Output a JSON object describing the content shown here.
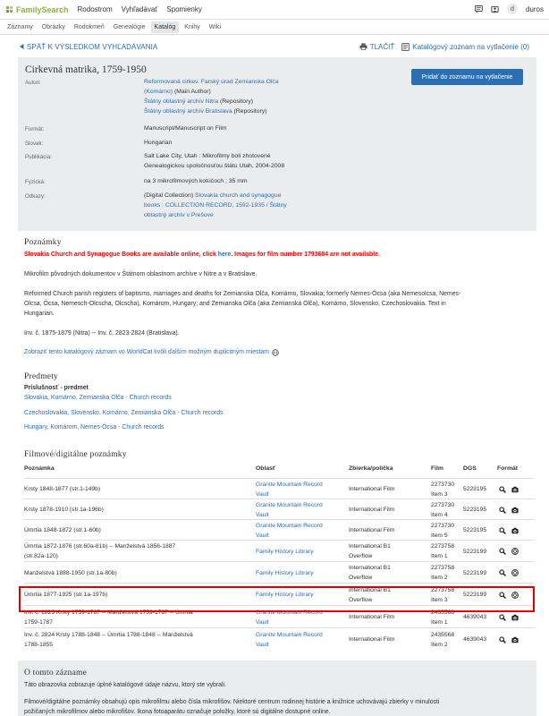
{
  "header": {
    "logo": "FamilySearch",
    "nav": [
      "Rodostrom",
      "Vyhľadávať",
      "Spomienky"
    ],
    "user": "duros",
    "avatar_letter": "d"
  },
  "subnav": {
    "tabs": [
      "Záznamy",
      "Obrázky",
      "Rodokmeň",
      "Genealógie",
      "Katalóg",
      "Knihy",
      "Wiki"
    ],
    "active": "Katalóg"
  },
  "actions": {
    "back": "SPÄŤ K VÝSLEDKOM VYHĽADÁVANIA",
    "print": "TLAČIŤ",
    "print_list": "Katalógový zoznam na vytlačenie (0)"
  },
  "record": {
    "title": "Cirkevná matrika, 1759-1950",
    "add_button": "Pridať do zoznamu na vytlačenie",
    "authors_label": "Autori:",
    "authors": [
      {
        "name": "Reformovaná cirkev. Farský úrad Zemianska Olča",
        "name2": "(Komárno)",
        "role": "(Main Author)"
      },
      {
        "name": "Štátny oblastný archív Nitra",
        "role": "(Repository)"
      },
      {
        "name": "Štátny oblastný archív Bratislava",
        "role": "(Repository)"
      }
    ],
    "format_label": "Formát:",
    "format": "Manuscript/Manuscript on Film",
    "language_label": "Slovak:",
    "language": "Hungarian",
    "publication_label": "Publikácia:",
    "publication_1": "Salt Lake City, Utah : Mikrofilmy boli zhotovené",
    "publication_2": "Genealogickou spoločnosťou štátu Utah, 2004-2008",
    "physical_label": "Fyzická:",
    "physical": "na 3 mikrofilmových kotúčoch ; 35 mm",
    "references_label": "Odkazy:",
    "ref_prefix": "(Digital Collection)",
    "ref_link_1": "Slovakia church and synagogue",
    "ref_link_2": "books : COLLECTION RECORD, 1592-1935 / Štátny",
    "ref_link_3": "oblastný archív v Prešove"
  },
  "notes": {
    "heading": "Poznámky",
    "red_1": "Slovakia Church and Synagogue Books are available online, click",
    "red_link": "here",
    "red_2": ". Images for film number 1793684 are not available.",
    "p1": "Mikrofilm pôvodných dokumentov v Štátnom oblastnom archíve v Nitre a v Bratislave.",
    "p2_1": "Reformed Church parish registers of baptisms, marriages and deaths for Zemianska Olča, Komárno, Slovakia; formerly Nemes-Ócsa (aka Nemesolcsa, Nemes-",
    "p2_2": "Olcsa, Ócsa, Nemesch-Olcscha, Olcscha), Komárom, Hungary; and Zemianska Olča (aka Zemianská Olča), Komárno, Slovensko, Czechoslovakia. Text in",
    "p2_3": "Hungarian.",
    "p3": "Inv. č. 1875-1879 (Nitra) -- Inv. č. 2823-2824 (Bratislava).",
    "worldcat": "Zobraziť tento katalógový záznam vo WorldCat kvôli ďalším možným duplicitným miestam"
  },
  "subjects": {
    "heading": "Predmety",
    "subheading": "Príslušnosť - predmet",
    "items": [
      "Slovakia, Komárno, Zemianska Olča - Church records",
      "Czechoslovakia, Slovensko, Komárno, Zemianska Olča - Church records",
      "Hungary, Komárom, Nemes-Ócsa - Church records"
    ]
  },
  "films": {
    "heading": "Filmové/digitálne poznámky",
    "columns": [
      "Poznámka",
      "Oblasť",
      "Zbierka/polička",
      "Film",
      "DGS",
      "Formát"
    ],
    "rows": [
      {
        "note": [
          "Krsty 1848-1877 (str.1-149b)"
        ],
        "area": [
          "Granite Mountain Record",
          "Vault"
        ],
        "coll": [
          "International Film"
        ],
        "film": [
          "2273730",
          "Item 3"
        ],
        "dgs": "5223195",
        "fmt": "camera"
      },
      {
        "note": [
          "Krsty 1878-1910 (str.1a-196b)"
        ],
        "area": [
          "Granite Mountain Record",
          "Vault"
        ],
        "coll": [
          "International Film"
        ],
        "film": [
          "2273730",
          "Item 4"
        ],
        "dgs": "5223195",
        "fmt": "camera"
      },
      {
        "note": [
          "Úmrtia 1848-1872 (str.1-60b)"
        ],
        "area": [
          "Granite Mountain Record",
          "Vault"
        ],
        "coll": [
          "International Film"
        ],
        "film": [
          "2273730",
          "Item 5"
        ],
        "dgs": "5223195",
        "fmt": "camera"
      },
      {
        "note": [
          "Úmrtia 1872-1876 (str.60a-81b) -- Manželstvá 1856-1887",
          "(str.82a-120)"
        ],
        "area": [
          "Family History Library"
        ],
        "coll": [
          "International B1",
          "Overflow"
        ],
        "film": [
          "2273758",
          "Item 1"
        ],
        "dgs": "5223199",
        "fmt": "reel"
      },
      {
        "note": [
          "Manželstvá 1888-1950 (str.1a-80b)"
        ],
        "area": [
          "Family History Library"
        ],
        "coll": [
          "International B1",
          "Overflow"
        ],
        "film": [
          "2273758",
          "Item 2"
        ],
        "dgs": "5223199",
        "fmt": "reel"
      },
      {
        "note": [
          "Úmrtia 1877-1925 (str.1a-197b)"
        ],
        "area": [
          "Family History Library"
        ],
        "coll": [
          "International B1",
          "Overflow"
        ],
        "film": [
          "2273758",
          "Item 3"
        ],
        "dgs": "5223199",
        "fmt": "reel"
      },
      {
        "note": [
          "Inv. č. 2823 Krsty 1759-1787 -- Manželstvá 1759-1787 -- Úmrtia",
          "1759-1787"
        ],
        "area": [
          "Granite Mountain Record",
          "Vault"
        ],
        "coll": [
          "International Film"
        ],
        "film": [
          "2435568",
          "Item 1"
        ],
        "dgs": "4639043",
        "fmt": "camera"
      },
      {
        "note": [
          "Inv. č. 2824 Krsty 1788-1848 -- Úmrtia 1788-1848 -- Manželstvá",
          "1788-1855"
        ],
        "area": [
          "Granite Mountain Record",
          "Vault"
        ],
        "coll": [
          "International Film"
        ],
        "film": [
          "2435568",
          "Item 2"
        ],
        "dgs": "4639043",
        "fmt": "camera"
      }
    ]
  },
  "about": {
    "heading": "O tomto zázname",
    "p1": "Táto obrazovka zobrazuje úplné katalógové údaje názvu, ktorý ste vybrali.",
    "p2_1": "Filmové/digitálne poznámky obsahujú opis mikrofilmu alebo čísla mikrofišov. Niektoré centrum rodinnej histórie a knižnice uchovávajú zbierky v minulosti",
    "p2_2": "požičaných mikrofilmov alebo mikrofišov. Ikona fotoaparátu označuje položky, ktoré sú digitálne dostupné online."
  },
  "colors": {
    "accent": "#2a6fb5",
    "logo_green": "#8cb43c",
    "alert_red": "#e00000",
    "highlight_border": "#e30000",
    "panel_gray": "#eaecee"
  }
}
